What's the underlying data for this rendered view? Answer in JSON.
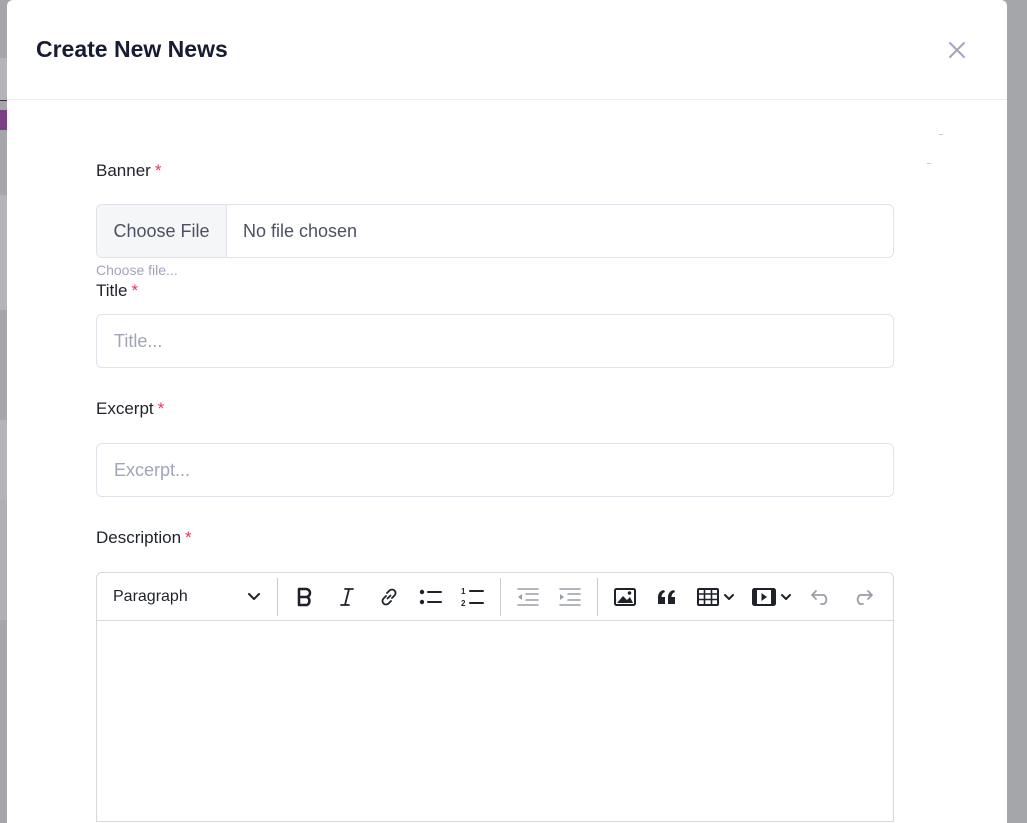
{
  "modal": {
    "title": "Create New News"
  },
  "form": {
    "banner": {
      "label": "Banner",
      "required_mark": "*",
      "button_label": "Choose File",
      "file_status": "No file chosen",
      "hint": "Choose file..."
    },
    "title": {
      "label": "Title",
      "required_mark": "*",
      "placeholder": "Title...",
      "value": ""
    },
    "excerpt": {
      "label": "Excerpt",
      "required_mark": "*",
      "placeholder": "Excerpt...",
      "value": ""
    },
    "description": {
      "label": "Description",
      "required_mark": "*",
      "heading_select": "Paragraph",
      "toolbar_icons": [
        "bold-icon",
        "italic-icon",
        "link-icon",
        "bulleted-list-icon",
        "numbered-list-icon",
        "outdent-icon",
        "indent-icon",
        "image-icon",
        "blockquote-icon",
        "table-icon",
        "media-icon",
        "undo-icon",
        "redo-icon"
      ]
    }
  },
  "colors": {
    "required": "#e8375a",
    "title_text": "#181c32",
    "border": "#e1e3ea",
    "placeholder": "#a1a5b7"
  }
}
